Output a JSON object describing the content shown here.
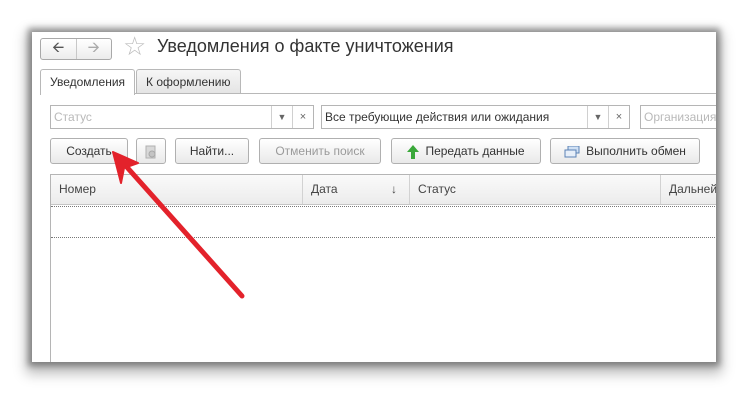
{
  "window": {
    "title": "Уведомления о факте уничтожения",
    "nav": {
      "back_icon": "arrow-left-icon",
      "forward_icon": "arrow-right-icon"
    },
    "favorite_icon": "star-icon"
  },
  "tabs": [
    {
      "label": "Уведомления",
      "active": true
    },
    {
      "label": "К оформлению",
      "active": false
    }
  ],
  "filters": {
    "status": {
      "placeholder": "Статус",
      "value": ""
    },
    "actions": {
      "value": "Все требующие действия или ожидания"
    },
    "organization": {
      "placeholder": "Организация",
      "value": ""
    }
  },
  "toolbar": {
    "create_label": "Создать",
    "find_label": "Найти...",
    "cancel_search_label": "Отменить поиск",
    "send_data_label": "Передать данные",
    "exchange_label": "Выполнить обмен"
  },
  "table": {
    "columns": [
      "Номер",
      "Дата",
      "Статус",
      "Дальней"
    ],
    "sort_column": "Дата",
    "sort_direction": "descending",
    "rows": []
  },
  "colors": {
    "annotation_arrow": "#e3222b",
    "send_icon": "#3aa83a"
  }
}
